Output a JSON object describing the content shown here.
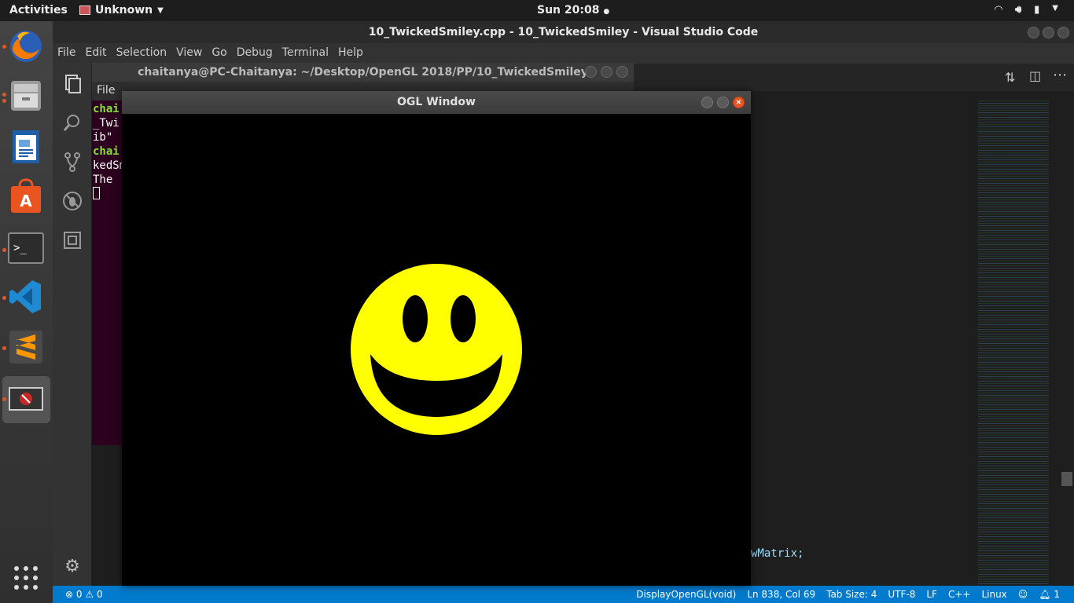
{
  "topbar": {
    "activities": "Activities",
    "app_name": "Unknown",
    "clock": "Sun 20:08",
    "status_icons": [
      "wifi-icon",
      "volume-icon",
      "battery-icon",
      "power-menu-icon"
    ]
  },
  "dock": {
    "items": [
      "Firefox",
      "Files",
      "LibreOffice Writer",
      "Ubuntu Software",
      "Terminal",
      "Visual Studio Code",
      "Sublime Text",
      "OGL Window"
    ]
  },
  "vscode": {
    "title": "10_TwickedSmiley.cpp - 10_TwickedSmiley - Visual Studio Code",
    "menu": [
      "File",
      "Edit",
      "Selection",
      "View",
      "Go",
      "Debug",
      "Terminal",
      "Help"
    ],
    "code_tail": "wMatrix;",
    "status": {
      "errors": "0",
      "warnings": "0",
      "function": "DisplayOpenGL(void)",
      "position": "Ln 838, Col 69",
      "tab_size": "Tab Size: 4",
      "encoding": "UTF-8",
      "eol": "LF",
      "language": "C++",
      "os": "Linux",
      "notifications": "1"
    }
  },
  "terminal": {
    "title": "chaitanya@PC-Chaitanya: ~/Desktop/OpenGL 2018/PP/10_TwickedSmiley",
    "menu_first": "File",
    "lines": [
      "chai",
      "_Twi",
      "ib\"",
      "chai",
      "kedSm",
      "The "
    ]
  },
  "ogl": {
    "title": "OGL Window",
    "smiley_color": "#ffff00",
    "background_color": "#000000"
  }
}
